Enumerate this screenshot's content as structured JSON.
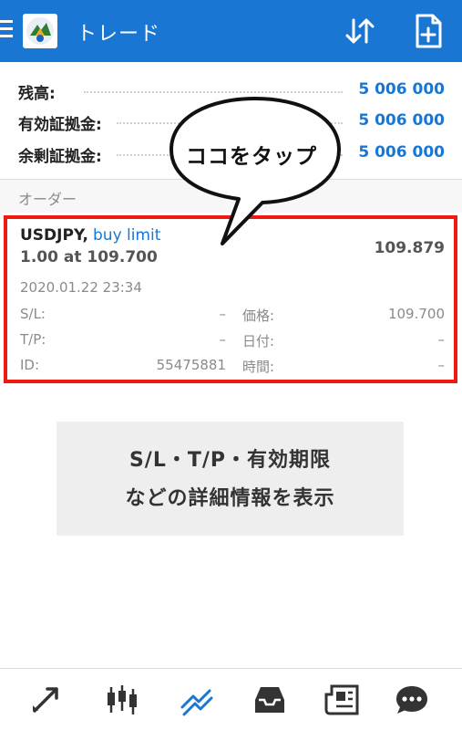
{
  "app": {
    "title": "トレード",
    "accent": "#1976D2"
  },
  "balances": [
    {
      "label": "残高:",
      "value": "5 006 000"
    },
    {
      "label": "有効証拠金:",
      "value": "5 006 000"
    },
    {
      "label": "余剰証拠金:",
      "value": "5 006 000"
    }
  ],
  "orders_section": {
    "title": "オーダー"
  },
  "order": {
    "symbol": "USDJPY,",
    "type": "buy limit",
    "volume": "1.00 at 109.700",
    "current_price": "109.879",
    "datetime": "2020.01.22 23:34",
    "sl_label": "S/L:",
    "sl_value": "–",
    "tp_label": "T/P:",
    "tp_value": "–",
    "id_label": "ID:",
    "id_value": "55475881",
    "price_label": "価格:",
    "price_value": "109.700",
    "date_label": "日付:",
    "date_value": "–",
    "time_label": "時間:",
    "time_value": "–"
  },
  "callout": {
    "text": "ココをタップ"
  },
  "info": {
    "line1": "S/L・T/P・有効期限",
    "line2": "などの詳細情報を表示"
  },
  "icons": {
    "menu": "menu-icon",
    "logo": "metatrader-logo",
    "sort": "sort-icon",
    "new_order": "new-order-icon",
    "nav": [
      "quotes-icon",
      "chart-icon",
      "trade-icon",
      "history-icon",
      "news-icon",
      "chat-icon"
    ]
  },
  "colors": {
    "highlight_border": "#f0190f",
    "active_nav": "#1976D2",
    "inactive_nav": "#333333"
  }
}
